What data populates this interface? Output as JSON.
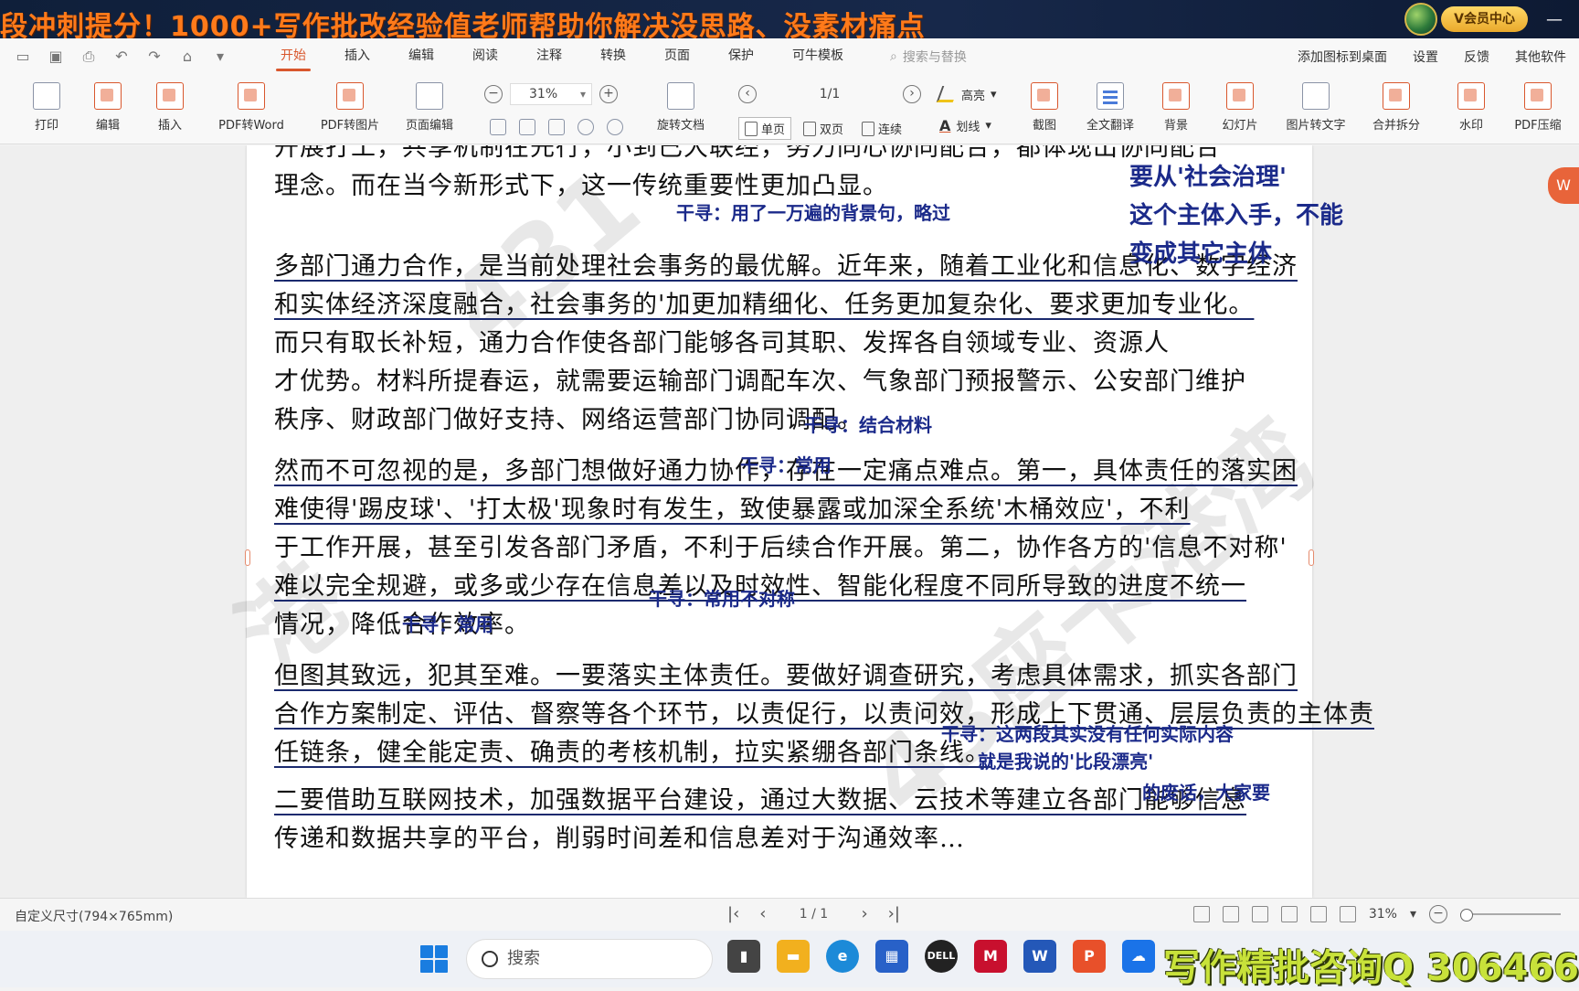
{
  "banner": {
    "headline": "段冲刺提分！1000+写作批改经验值老师帮助你解决没思路、没素材痛点",
    "vip_label": "V会员中心"
  },
  "menubar": {
    "tabs": [
      "开始",
      "插入",
      "编辑",
      "阅读",
      "注释",
      "转换",
      "页面",
      "保护",
      "可牛模板"
    ],
    "active_tab": "开始",
    "search_placeholder": "搜索与替换",
    "right_items": [
      "添加图标到桌面",
      "设置",
      "反馈",
      "其他软件"
    ]
  },
  "toolbar": {
    "print": "打印",
    "edit": "编辑",
    "insert": "插入",
    "pdf_to_word": "PDF转Word",
    "pdf_to_image": "PDF转图片",
    "page_edit": "页面编辑",
    "zoom_value": "31%",
    "rotate_doc": "旋转文档",
    "page_indicator": "1/1",
    "single_page": "单页",
    "double_page": "双页",
    "continuous": "连续",
    "highlight": "高亮",
    "strikethrough": "划线",
    "screenshot": "截图",
    "full_translate": "全文翻译",
    "background": "背景",
    "slideshow": "幻灯片",
    "image_to_text": "图片转文字",
    "merge_split": "合并拆分",
    "watermark": "水印",
    "pdf_compress": "PDF压缩"
  },
  "document": {
    "lines": [
      "开展打工，共享机制在先行，小到已大联经，努力同心协同配合，都体现出协同配合",
      "理念。而在当今新形式下，这一传统重要性更加凸显。",
      "",
      "多部门通力合作，是当前处理社会事务的最优解。近年来，随着工业化和信息化、数字经济",
      "和实体经济深度融合，社会事务的'加更加精细化、任务更加复杂化、要求更加专业化。",
      "而只有取长补短，通力合作使各部门能够各司其职、发挥各自领域专业、资源人",
      "才优势。材料所提春运，就需要运输部门调配车次、气象部门预报警示、公安部门维护",
      "秩序、财政部门做好支持、网络运营部门协同调配。",
      "然而不可忽视的是，多部门想做好通力协作，存在一定痛点难点。第一，具体责任的落实困",
      "难使得'踢皮球'、'打太极'现象时有发生，致使暴露或加深全系统'木桶效应'，不利",
      "于工作开展，甚至引发各部门矛盾，不利于后续合作开展。第二，协作各方的'信息不对称'",
      "难以完全规避，或多或少存在信息差以及时效性、智能化程度不同所导致的进度不统一",
      "情况，降低合作效率。",
      "但图其致远，犯其至难。一要落实主体责任。要做好调查研究，考虑具体需求，抓实各部门",
      "合作方案制定、评估、督察等各个环节，以责促行，以责问效，形成上下贯通、层层负责的主体责",
      "任链条，健全能定责、确责的考核机制，拉实紧绷各部门条线。",
      "二要借助互联网技术，加强数据平台建设，通过大数据、云技术等建立各部门能够信息",
      "传递和数据共享的平台，削弱时间差和信息差对于沟通效率…"
    ],
    "annotations": [
      "干寻：用了一万遍的背景句，略过",
      "干寻：结合材料",
      "干寻：常用",
      "干寻：常用不对称",
      "干寻：常用",
      "干寻：这两段其实没有任何实际内容",
      "就是我说的'比段漂亮'",
      "的废话，大家要"
    ],
    "margin_note": [
      "要从'社会治理'",
      "这个主体入手，不能",
      "变成其它主体"
    ],
    "watermarks": [
      "431",
      "43座卡港湾",
      "港"
    ]
  },
  "statusbar": {
    "page_size": "自定义尺寸(794×765mm)",
    "page_indicator": "1 / 1",
    "zoom": "31%"
  },
  "taskbar": {
    "search_label": "搜索",
    "ad_text": "写作精批咨询Q 306466"
  }
}
